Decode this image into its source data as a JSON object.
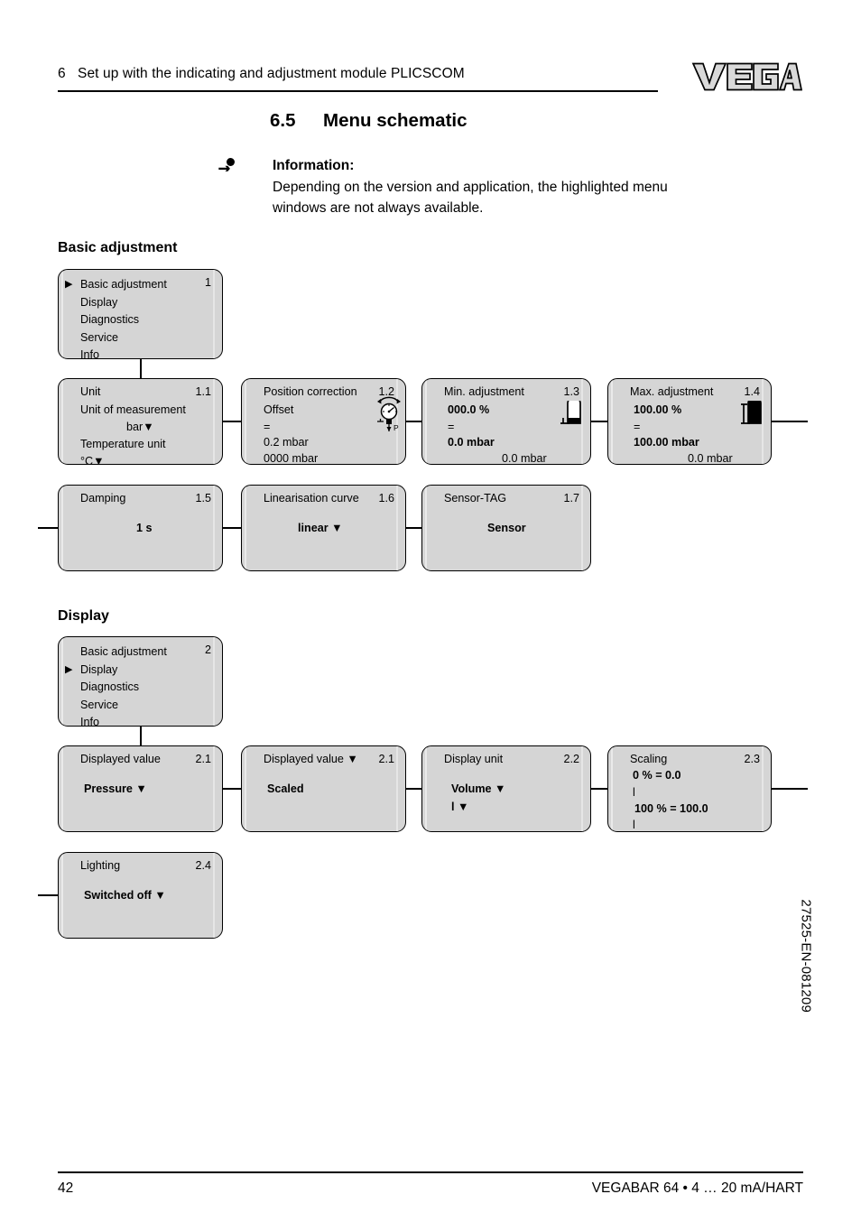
{
  "header": {
    "chapter_number": "6",
    "chapter_title": "Set up with the indicating and adjustment module PLICSCOM",
    "logo_text": "VEGA"
  },
  "section": {
    "number": "6.5",
    "title": "Menu schematic"
  },
  "info_note": {
    "icon": "info-icon",
    "title": "Information:",
    "line1": "Depending on the version and application, the highlighted menu",
    "line2": "windows are not always available."
  },
  "groups": {
    "basic": {
      "title": "Basic adjustment"
    },
    "display": {
      "title": "Display"
    }
  },
  "menu_basic": {
    "root": {
      "number": "1",
      "items": [
        {
          "label": "Basic adjustment",
          "selected": true
        },
        {
          "label": "Display",
          "selected": false
        },
        {
          "label": "Diagnostics",
          "selected": false
        },
        {
          "label": "Service",
          "selected": false
        },
        {
          "label": "Info",
          "selected": false
        }
      ]
    },
    "unit": {
      "number": "1.1",
      "title": "Unit",
      "label_measurement": "Unit of measurement",
      "value_measurement": "bar▼",
      "label_temperature": "Temperature unit",
      "value_temperature": "°C▼"
    },
    "position_correction": {
      "number": "1.2",
      "title": "Position correction",
      "label_offset": "Offset",
      "equals": "=",
      "value_offset": "0.2 mbar",
      "value_raw": "0000 mbar",
      "icon": "pressure-gauge-icon",
      "icon_label": "P"
    },
    "min_adjustment": {
      "number": "1.3",
      "title": "Min. adjustment",
      "percent": "000.0 %",
      "equals": "=",
      "value": "0.0 mbar",
      "current": "0.0 mbar",
      "icon": "tank-empty-icon"
    },
    "max_adjustment": {
      "number": "1.4",
      "title": "Max. adjustment",
      "percent": "100.00 %",
      "equals": "=",
      "value": "100.00 mbar",
      "current": "0.0 mbar",
      "icon": "tank-full-icon"
    },
    "damping": {
      "number": "1.5",
      "title": "Damping",
      "value": "1 s"
    },
    "linearisation": {
      "number": "1.6",
      "title": "Linearisation curve",
      "value": "linear ▼"
    },
    "sensor_tag": {
      "number": "1.7",
      "title": "Sensor-TAG",
      "value": "Sensor"
    }
  },
  "menu_display": {
    "root": {
      "number": "2",
      "items": [
        {
          "label": "Basic adjustment",
          "selected": false
        },
        {
          "label": "Display",
          "selected": true
        },
        {
          "label": "Diagnostics",
          "selected": false
        },
        {
          "label": "Service",
          "selected": false
        },
        {
          "label": "Info",
          "selected": false
        }
      ]
    },
    "displayed_value": {
      "number": "2.1",
      "title": "Displayed value",
      "value": "Pressure ▼"
    },
    "displayed_value_scaled": {
      "number": "2.1",
      "title": "Displayed value ▼",
      "value": "Scaled"
    },
    "display_unit": {
      "number": "2.2",
      "title": "Display unit",
      "value1": "Volume ▼",
      "value2": "l ▼"
    },
    "scaling": {
      "number": "2.3",
      "title": "Scaling",
      "line1": "0 % = 0.0",
      "line2": "l",
      "line3": "100 % = 100.0",
      "line4": "l"
    },
    "lighting": {
      "number": "2.4",
      "title": "Lighting",
      "value": "Switched off ▼"
    }
  },
  "footer": {
    "page_number": "42",
    "product": "VEGABAR 64 • 4 … 20 mA/HART",
    "document_code": "27525-EN-081209"
  },
  "colors": {
    "box_fill": "#d5d5d5",
    "box_border": "#000000",
    "page_background": "#ffffff"
  }
}
